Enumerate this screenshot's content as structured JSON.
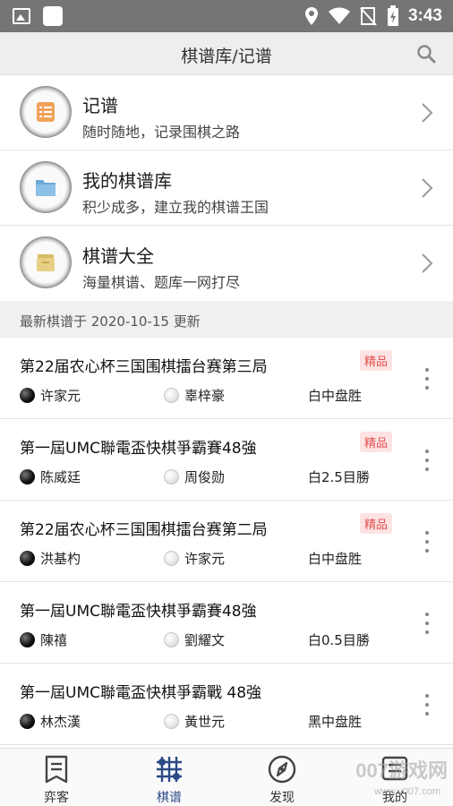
{
  "status_bar": {
    "time": "3:43",
    "icons": [
      "image-icon",
      "app-square-icon",
      "location-icon",
      "wifi-icon",
      "no-signal-icon",
      "battery-charging-icon"
    ]
  },
  "header": {
    "title": "棋谱库/记谱",
    "search_icon": "search-icon"
  },
  "menu": [
    {
      "title": "记谱",
      "subtitle": "随时随地，记录围棋之路",
      "icon": "notebook-icon",
      "color": "#f0a25a"
    },
    {
      "title": "我的棋谱库",
      "subtitle": "积少成多，建立我的棋谱王国",
      "icon": "folder-icon",
      "color": "#6aa9d8"
    },
    {
      "title": "棋谱大全",
      "subtitle": "海量棋谱、题库一网打尽",
      "icon": "archive-box-icon",
      "color": "#e7cf85"
    }
  ],
  "section": {
    "label": "最新棋谱于 2020-10-15 更新"
  },
  "games": [
    {
      "title": "第22届农心杯三国围棋擂台赛第三局",
      "badge": "精品",
      "black": "许家元",
      "white": "辜梓豪",
      "result": "白中盘胜"
    },
    {
      "title": "第一屆UMC聯電盃快棋爭霸賽48強",
      "badge": "精品",
      "black": "陈威廷",
      "white": "周俊勋",
      "result": "白2.5目勝"
    },
    {
      "title": "第22届农心杯三国围棋擂台赛第二局",
      "badge": "精品",
      "black": "洪基杓",
      "white": "许家元",
      "result": "白中盘胜"
    },
    {
      "title": "第一屆UMC聯電盃快棋爭霸賽48強",
      "badge": "",
      "black": "陳禧",
      "white": "劉耀文",
      "result": "白0.5目勝"
    },
    {
      "title": "第一屆UMC聯電盃快棋爭霸戰 48強",
      "badge": "",
      "black": "林杰漢",
      "white": "黃世元",
      "result": "黑中盘胜"
    }
  ],
  "bottom_nav": {
    "items": [
      {
        "label": "弈客",
        "icon": "board-record-icon"
      },
      {
        "label": "棋谱",
        "icon": "go-grid-icon"
      },
      {
        "label": "发现",
        "icon": "compass-icon"
      },
      {
        "label": "我的",
        "icon": "profile-icon"
      }
    ],
    "active_index": 1,
    "active_color": "#2b4a86"
  },
  "watermark": {
    "text": "007游戏网",
    "url": "www.y007.com"
  }
}
